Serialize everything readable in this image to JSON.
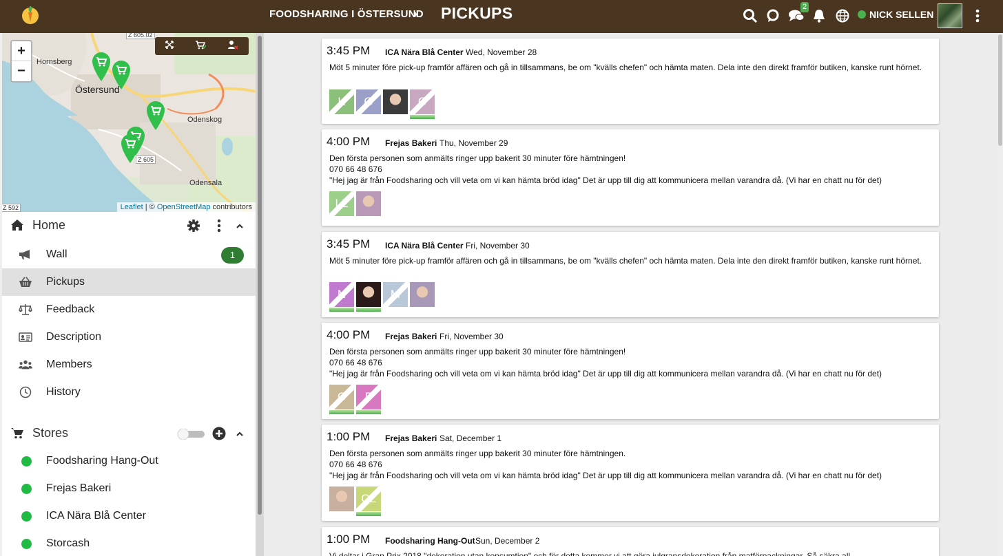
{
  "header": {
    "group_name": "FOODSHARING I ÖSTERSUND",
    "separator": "›",
    "page_title": "PICKUPS",
    "messages_badge": "2",
    "user_name": "NICK SELLEN"
  },
  "map": {
    "labels": {
      "hornsberg": "Hornsberg",
      "ostersund": "Östersund",
      "odenskog": "Odenskog",
      "odensala": "Odensala",
      "z605": "Z 605",
      "z605_02": "Z 605.02",
      "z592": "Z 592"
    },
    "zoom_in": "+",
    "zoom_out": "−",
    "attribution": {
      "leaflet": "Leaflet",
      "sep": " | © ",
      "osm": "OpenStreetMap",
      "contributors": " contributors"
    }
  },
  "sidebar": {
    "home_title": "Home",
    "nav": [
      {
        "label": "Wall",
        "icon": "megaphone-icon",
        "badge": "1"
      },
      {
        "label": "Pickups",
        "icon": "basket-icon",
        "active": true
      },
      {
        "label": "Feedback",
        "icon": "scale-icon"
      },
      {
        "label": "Description",
        "icon": "id-card-icon"
      },
      {
        "label": "Members",
        "icon": "users-icon"
      },
      {
        "label": "History",
        "icon": "clock-icon"
      }
    ],
    "stores_title": "Stores",
    "stores": [
      {
        "label": "Foodsharing Hang-Out",
        "status_color": "#21ba45"
      },
      {
        "label": "Frejas Bakeri",
        "status_color": "#21ba45"
      },
      {
        "label": "ICA Nära Blå Center",
        "status_color": "#21ba45"
      },
      {
        "label": "Storcash",
        "status_color": "#21ba45"
      }
    ]
  },
  "pickups": [
    {
      "time": "3:45 PM",
      "store": "ICA Nära Blå Center",
      "date": "Wed, November 28",
      "lines": [
        "Möt 5 minuter före pick-up framför affären och gå in tillsammans, be om \"kvälls chefen\" och hämta maten. Dela inte den direkt framför butiken, kanske runt hörnet."
      ],
      "slots": [
        {
          "letter": "K",
          "color": "#8bc07a",
          "joined": false
        },
        {
          "letter": "G",
          "color": "#9aa0c8",
          "joined": false
        },
        {
          "letter": "",
          "color": "#3b3b3b",
          "joined": false,
          "photo": true
        },
        {
          "letter": "C",
          "color": "#c8a8c0",
          "joined": true
        }
      ]
    },
    {
      "time": "4:00 PM",
      "store": "Frejas Bakeri",
      "date": "Thu, November 29",
      "lines": [
        "Den första personen som anmälts ringer upp bakerit 30 minuter före hämtningen!",
        "070 66 48 676",
        "\"Hej jag är från Foodsharing och vill veta om vi kan hämta bröd idag\" Det är upp till dig att kommunicera mellan varandra då. (Vi har en chatt nu för det)"
      ],
      "slots": [
        {
          "letter": "LL",
          "color": "#9ccf8a",
          "joined": false
        },
        {
          "letter": "",
          "color": "#b89ab8",
          "joined": false,
          "photo": true
        }
      ]
    },
    {
      "time": "3:45 PM",
      "store": "ICA Nära Blå Center",
      "date": "Fri, November 30",
      "lines": [
        "Möt 5 minuter före pick-up framför affären och gå in tillsammans, be om \"kvälls chefen\" och hämta maten. Dela inte den direkt framför butiken, kanske runt hörnet."
      ],
      "slots": [
        {
          "letter": "N",
          "color": "#c07ad0",
          "joined": true
        },
        {
          "letter": "",
          "color": "#2a1a1a",
          "joined": true,
          "photo": true
        },
        {
          "letter": "M",
          "color": "#b8c8d8",
          "joined": false
        },
        {
          "letter": "",
          "color": "#a898b8",
          "joined": false,
          "photo": true
        }
      ]
    },
    {
      "time": "4:00 PM",
      "store": "Frejas Bakeri",
      "date": "Fri, November 30",
      "lines": [
        "Den första personen som anmälts ringer upp bakerit 30 minuter före hämtningen!",
        "070 66 48 676",
        "\"Hej jag är från Foodsharing och vill veta om vi kan hämta bröd idag\" Det är upp till dig att kommunicera mellan varandra då. (Vi har en chatt nu för det)"
      ],
      "slots": [
        {
          "letter": "C",
          "color": "#c8b898",
          "joined": true
        },
        {
          "letter": "F",
          "color": "#d878c0",
          "joined": true
        }
      ]
    },
    {
      "time": "1:00 PM",
      "store": "Frejas Bakeri",
      "date": "Sat, December 1",
      "lines": [
        "Den första personen som anmälts ringer upp bakerit 30 minuter före hämtningen.",
        "070 66 48 676",
        "\"Hej jag är från Foodsharing och vill veta om vi kan hämta bröd idag\" Det är upp till dig att kommunicera mellan varandra då. (Vi har en chatt nu för det)"
      ],
      "slots": [
        {
          "letter": "",
          "color": "#c8b0a0",
          "joined": false,
          "photo": true
        },
        {
          "letter": "CL",
          "color": "#c8d878",
          "joined": true
        }
      ]
    },
    {
      "time": "1:00 PM",
      "store": "Foodsharing Hang-Out",
      "date": "Sun, December 2",
      "lines": [
        "Vi deltar i Gran Prix 2018 \"dekoration utan konsumtion\" och för detta kommer vi att göra julgransdekoration från matförpackningar. Så säkra all"
      ],
      "slots": []
    }
  ]
}
